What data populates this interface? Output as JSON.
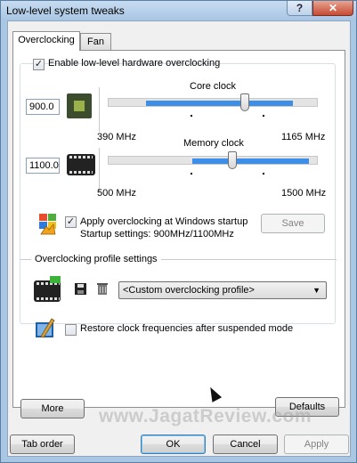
{
  "window": {
    "title": "Low-level system tweaks",
    "help_label": "?",
    "close_label": "✕"
  },
  "tabs": [
    {
      "label": "Overclocking",
      "active": true
    },
    {
      "label": "Fan",
      "active": false
    }
  ],
  "enable_checkbox": {
    "label": "Enable low-level hardware overclocking",
    "checked": true
  },
  "core": {
    "title": "Core clock",
    "value": "900.0",
    "min_label": "390 MHz",
    "max_label": "1165 MHz",
    "min": 390,
    "max": 1165,
    "current": 900,
    "range_low": 530,
    "range_high": 1075,
    "icon": "gpu-chip-icon"
  },
  "memory": {
    "title": "Memory clock",
    "value": "1100.0",
    "min_label": "500 MHz",
    "max_label": "1500 MHz",
    "min": 500,
    "max": 1500,
    "current": 1100,
    "range_low": 900,
    "range_high": 1460,
    "icon": "memory-film-icon"
  },
  "startup": {
    "checkbox_label": "Apply overclocking at Windows startup",
    "checked": true,
    "settings_text": "Startup settings: 900MHz/1100MHz",
    "save_label": "Save",
    "icon": "windows-logo-icon"
  },
  "profiles": {
    "section_label": "Overclocking profile settings",
    "selected": "<Custom overclocking profile>",
    "icons": [
      "profile-film-icon",
      "save-disk-icon",
      "trash-icon"
    ]
  },
  "restore": {
    "label": "Restore clock frequencies after suspended mode",
    "checked": false,
    "icon": "brush-tool-icon"
  },
  "buttons": {
    "more": "More",
    "defaults": "Defaults",
    "tab_order": "Tab order",
    "ok": "OK",
    "cancel": "Cancel",
    "apply": "Apply"
  },
  "watermark": "www.JagatReview.com",
  "colors": {
    "accent": "#3d8ee6",
    "titlebar": "#a8c5e3",
    "close": "#c74a33"
  }
}
